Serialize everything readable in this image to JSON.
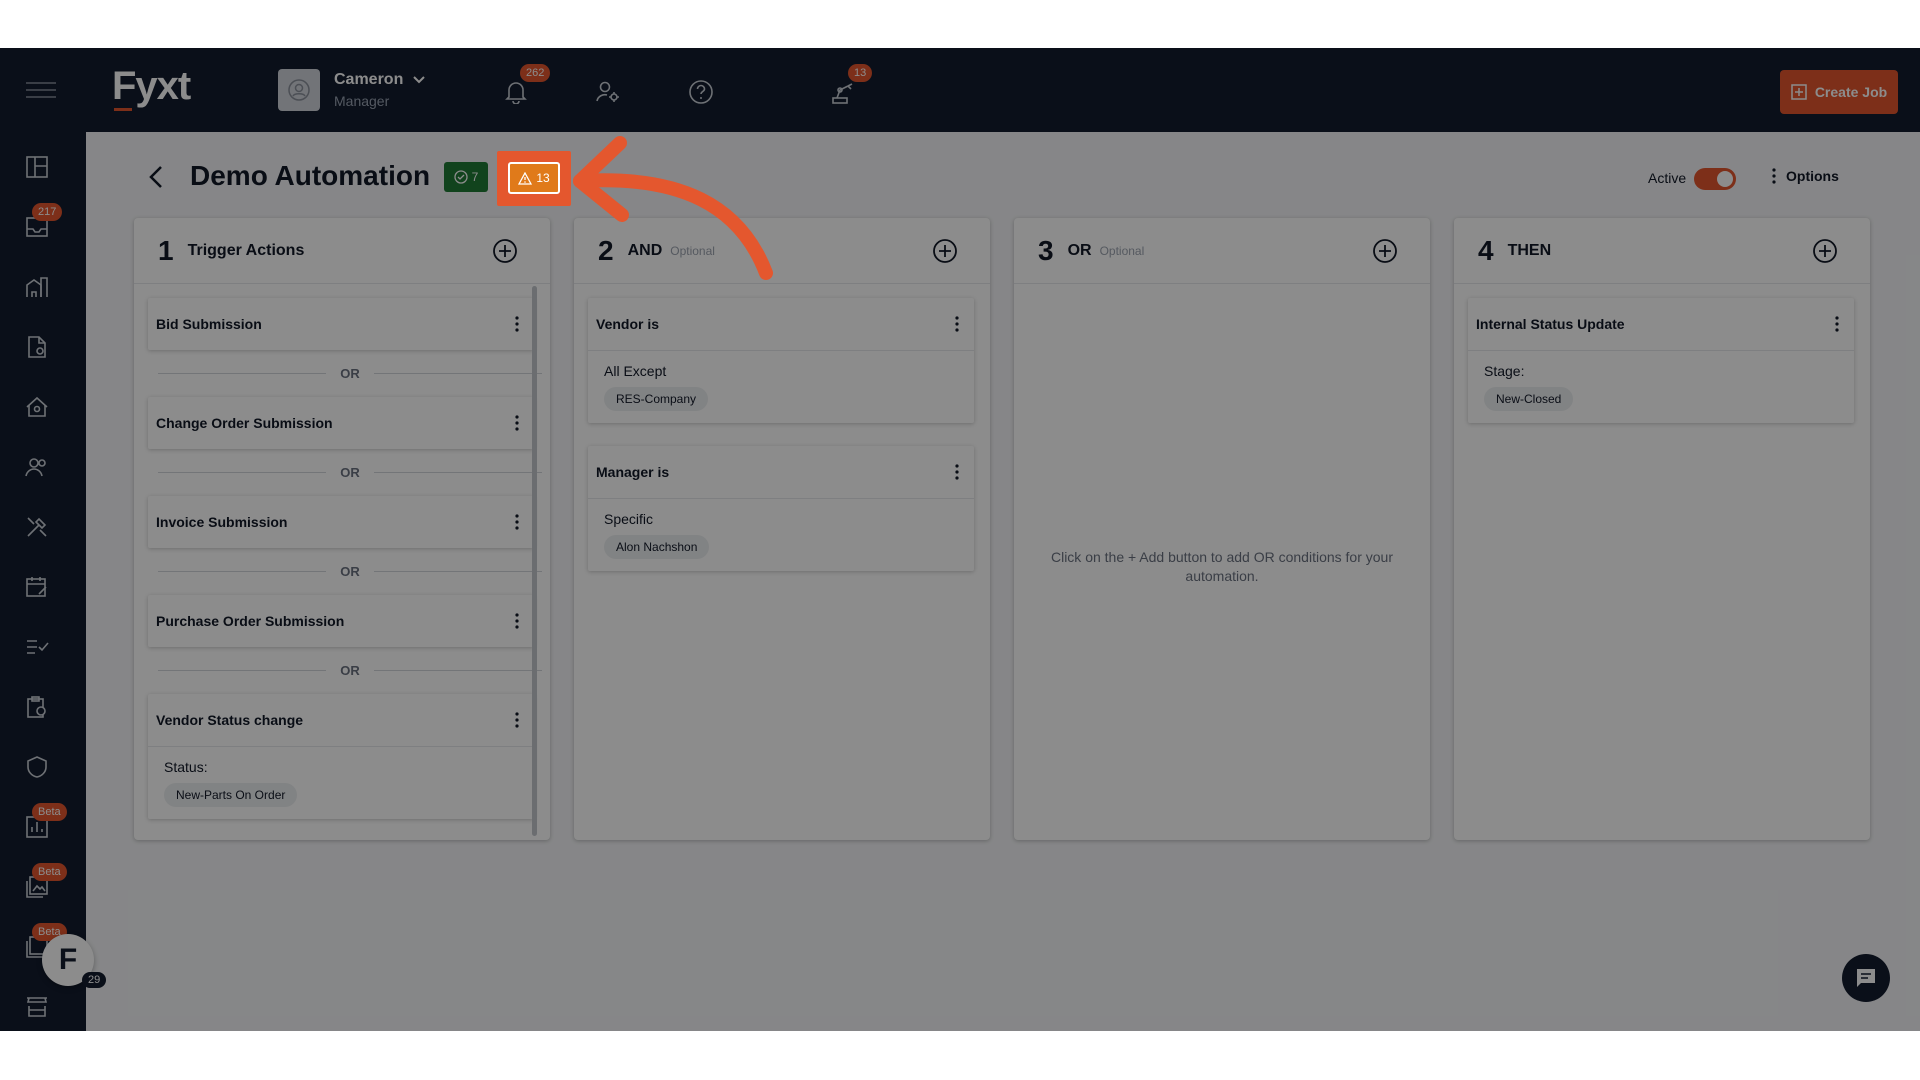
{
  "app": {
    "logo": "Fyxt"
  },
  "user": {
    "name": "Cameron",
    "role": "Manager"
  },
  "topbar": {
    "notifications_count": "262",
    "robot_count": "13",
    "create_job_label": "Create Job"
  },
  "sidebar": {
    "inbox_count": "217",
    "beta_label": "Beta",
    "fyxt_letter": "F",
    "fyxt_count": "29"
  },
  "header": {
    "title": "Demo Automation",
    "ok_count": "7",
    "warning_count": "13",
    "active_label": "Active",
    "options_label": "Options"
  },
  "columns": [
    {
      "num": "1",
      "title": "Trigger Actions",
      "optional": ""
    },
    {
      "num": "2",
      "title": "AND",
      "optional": "Optional"
    },
    {
      "num": "3",
      "title": "OR",
      "optional": "Optional"
    },
    {
      "num": "4",
      "title": "THEN",
      "optional": ""
    }
  ],
  "or_label": "OR",
  "triggers": [
    {
      "title": "Bid Submission"
    },
    {
      "title": "Change Order Submission"
    },
    {
      "title": "Invoice Submission"
    },
    {
      "title": "Purchase Order Submission"
    },
    {
      "title": "Vendor Status change",
      "label": "Status:",
      "chip": "New-Parts On Order"
    }
  ],
  "and_conditions": [
    {
      "title": "Vendor is",
      "label": "All Except",
      "chip": "RES-Company"
    },
    {
      "title": "Manager is",
      "label": "Specific",
      "chip": "Alon Nachshon"
    }
  ],
  "or_empty_message": "Click on the + Add button to add OR conditions for your automation.",
  "then_actions": [
    {
      "title": "Internal Status Update",
      "label": "Stage:",
      "chip": "New-Closed"
    }
  ]
}
